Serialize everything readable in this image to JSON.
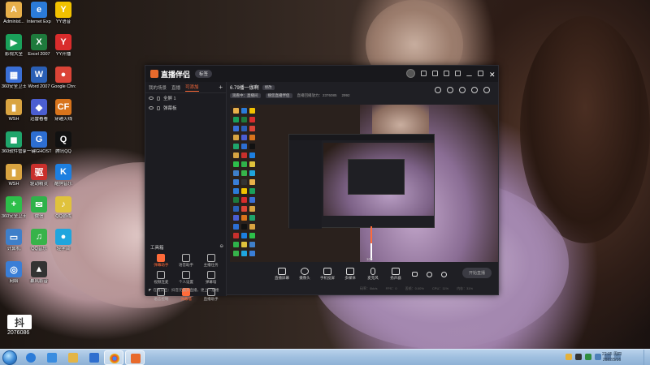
{
  "desktop": {
    "icons": [
      {
        "label": "Administ...",
        "glyph": "A",
        "color": "#e8b04a",
        "name": "admin-folder-icon"
      },
      {
        "label": "Internet Explorer",
        "glyph": "e",
        "color": "#2b7bd8",
        "name": "internet-explorer-icon"
      },
      {
        "label": "YY语音",
        "glyph": "Y",
        "color": "#f2c200",
        "name": "yy-voice-icon"
      },
      {
        "label": "影视大全",
        "glyph": "▶",
        "color": "#1aa05a",
        "name": "video-app-icon"
      },
      {
        "label": "Excel 2007",
        "glyph": "X",
        "color": "#1e7a3c",
        "name": "excel-icon"
      },
      {
        "label": "YY开播",
        "glyph": "Y",
        "color": "#d92c2c",
        "name": "yy-live-icon"
      },
      {
        "label": "360安全卫士",
        "glyph": "▦",
        "color": "#3a6fd6",
        "name": "security-360-icon"
      },
      {
        "label": "Word 2007",
        "glyph": "W",
        "color": "#2a5fb5",
        "name": "word-icon"
      },
      {
        "label": "Google Chrome",
        "glyph": "●",
        "color": "#db4437",
        "name": "chrome-icon"
      },
      {
        "label": "WSH",
        "glyph": "▮",
        "color": "#d9a441",
        "name": "wsh-folder-icon"
      },
      {
        "label": "迅雷看看",
        "glyph": "◆",
        "color": "#4b5ed1",
        "name": "thunder-icon"
      },
      {
        "label": "穿越火线",
        "glyph": "CF",
        "color": "#d8741c",
        "name": "game-cf-icon"
      },
      {
        "label": "360软件管家",
        "glyph": "◼",
        "color": "#1fa56b",
        "name": "software-manager-icon"
      },
      {
        "label": "一键GHOST",
        "glyph": "G",
        "color": "#2d6ed1",
        "name": "ghost-icon"
      },
      {
        "label": "腾讯QQ",
        "glyph": "Q",
        "color": "#111111",
        "name": "qq-icon"
      },
      {
        "label": "WSH",
        "glyph": "▮",
        "color": "#d9a441",
        "name": "wsh-folder-2-icon"
      },
      {
        "label": "驱动精灵",
        "glyph": "驱",
        "color": "#c9302c",
        "name": "driver-icon"
      },
      {
        "label": "酷狗音乐",
        "glyph": "K",
        "color": "#1d7fe0",
        "name": "kugou-icon"
      },
      {
        "label": "360安全卫士",
        "glyph": "+",
        "color": "#2dbf4a",
        "name": "security-360-2-icon"
      },
      {
        "label": "微信",
        "glyph": "✉",
        "color": "#2fb24a",
        "name": "wechat-icon"
      },
      {
        "label": "QQ游戏",
        "glyph": "♪",
        "color": "#e0c23c",
        "name": "qq-game-icon"
      },
      {
        "label": "计算机",
        "glyph": "▭",
        "color": "#3f7fc9",
        "name": "computer-icon"
      },
      {
        "label": "QQ音乐",
        "glyph": "♫",
        "color": "#37b34a",
        "name": "qq-music-icon"
      },
      {
        "label": "轻学台",
        "glyph": "●",
        "color": "#1fa5dd",
        "name": "study-icon"
      },
      {
        "label": "网络",
        "glyph": "◎",
        "color": "#3a7ed6",
        "name": "network-icon"
      },
      {
        "label": "暴风影音",
        "glyph": "▲",
        "color": "#333333",
        "name": "baofeng-icon"
      }
    ],
    "watermark_logo": "抖",
    "watermark_text": "2076086"
  },
  "app": {
    "name": "直播伴侣",
    "version": "标签",
    "tabs": [
      "我的场景",
      "直播",
      "可添加"
    ],
    "sources": [
      "全屏 1",
      "弹幕板"
    ],
    "room_title": "6.79播一伽啊",
    "room_chip": "修改",
    "room_meta": [
      "观看中：直播间",
      "搜您直播伴侣",
      "直播回播放力：2376085",
      "2992"
    ],
    "tools_title": "工具箱",
    "tools": [
      {
        "label": "弹幕助手",
        "hot": true,
        "name": "danmu-tool"
      },
      {
        "label": "语音助手",
        "hot": false,
        "name": "voice-tool"
      },
      {
        "label": "主播任务",
        "hot": false,
        "name": "task-tool"
      },
      {
        "label": "视频连麦",
        "hot": false,
        "name": "video-link-tool"
      },
      {
        "label": "个人设置",
        "hot": false,
        "name": "settings-tool"
      },
      {
        "label": "弹幕墙",
        "hot": false,
        "name": "danmu-wall-tool"
      },
      {
        "label": "语言控制",
        "hot": false,
        "name": "language-tool"
      },
      {
        "label": "弹幕墙",
        "hot": true,
        "name": "danmu-wall-2-tool"
      },
      {
        "label": "直播助手",
        "hot": false,
        "name": "live-assistant-tool"
      }
    ],
    "notice": "在线公告：抖音元霸开直播，更上一层楼",
    "controls": [
      "直播屏幕",
      "摄像头",
      "手机投屏",
      "多媒体",
      "麦克风",
      "扬声器"
    ],
    "volume_value": "100",
    "volume_level": 0.5,
    "start_button": "开始直播",
    "stats": [
      "码率：0kb/s",
      "FPS：0",
      "丢帧：0.00%",
      "CPU：11%",
      "内存：31%"
    ]
  },
  "taskbar": {
    "clock_time": "22:05 周四",
    "clock_date": "2022/5/16"
  }
}
